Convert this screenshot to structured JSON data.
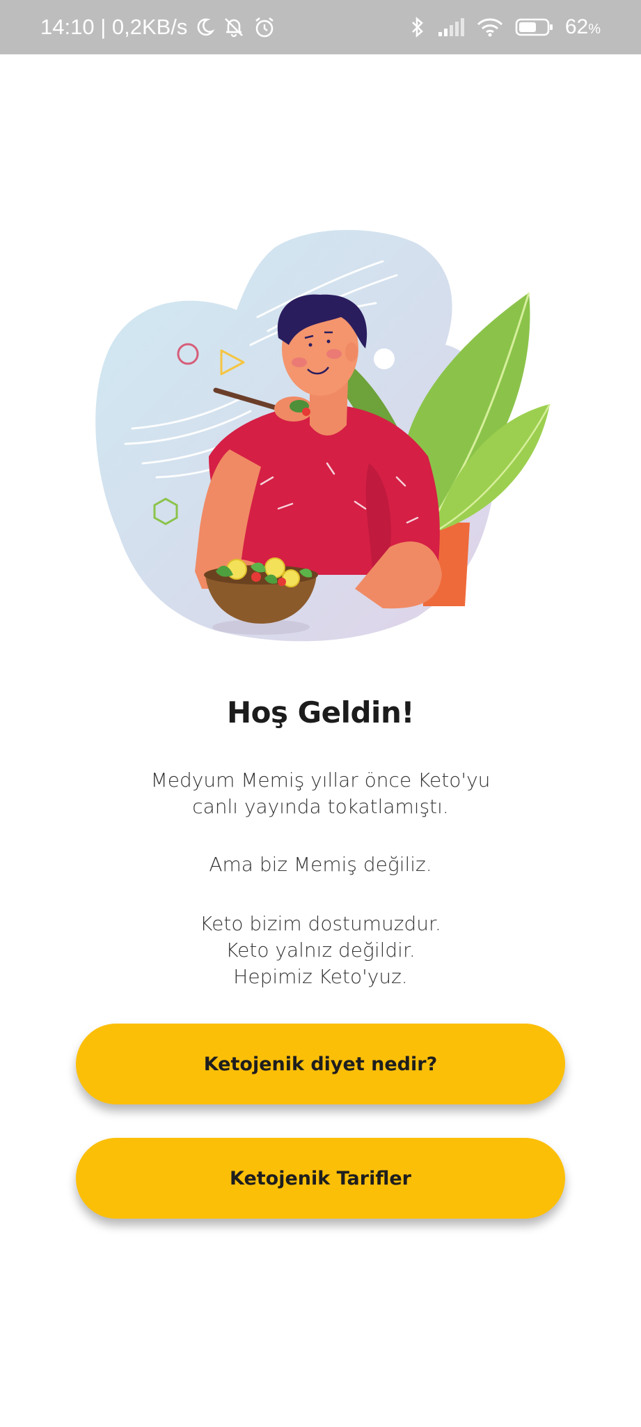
{
  "status_bar": {
    "time_speed": "14:10 | 0,2KB/s",
    "battery_percent": "62",
    "battery_unit": "%",
    "battery_level": 0.62,
    "icons": [
      "moon-icon",
      "notifications-off-icon",
      "alarm-icon",
      "bluetooth-icon",
      "signal-icon",
      "wifi-icon",
      "battery-icon"
    ]
  },
  "welcome": {
    "title": "Hoş Geldin!",
    "paragraph1": [
      "Medyum Memiş yıllar önce Keto'yu",
      "canlı yayında tokatlamıştı."
    ],
    "paragraph2": [
      "Ama biz Memiş değiliz."
    ],
    "paragraph3": [
      "Keto bizim dostumuzdur.",
      "Keto yalnız değildir.",
      "Hepimiz Keto'yuz."
    ]
  },
  "buttons": {
    "what_is_keto": "Ketojenik diyet nedir?",
    "recipes": "Ketojenik Tarifler"
  },
  "colors": {
    "accent": "#fcbf08",
    "status_bar": "#bdbdbd",
    "shirt": "#d51f45",
    "leaf": "#8bc34a",
    "pot": "#ef6a3a"
  }
}
